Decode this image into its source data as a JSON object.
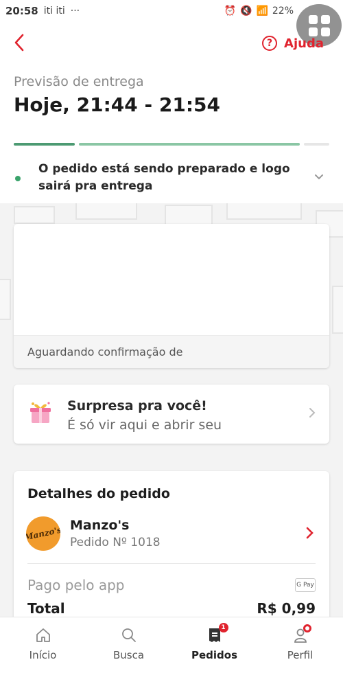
{
  "status_bar": {
    "time": "20:58",
    "apps": "iti iti",
    "more": "···",
    "battery": "22%"
  },
  "header": {
    "help_label": "Ajuda"
  },
  "delivery": {
    "estimate_label": "Previsão de entrega",
    "estimate_time": "Hoje, 21:44 - 21:54",
    "status_text": "O pedido está sendo preparado e logo sairá pra entrega"
  },
  "store_card": {
    "footer_text": "Aguardando confirmação de"
  },
  "surprise": {
    "title": "Surpresa pra você!",
    "subtitle": "É só vir aqui e abrir seu"
  },
  "order_details": {
    "heading": "Detalhes do pedido",
    "store_name": "Manzo's",
    "logo_text": "Manzo's",
    "order_number": "Pedido Nº 1018",
    "payment_label": "Pago pelo app",
    "payment_method": "G Pay",
    "total_label": "Total",
    "total_value": "R$ 0,99"
  },
  "bottom_nav": {
    "items": [
      {
        "label": "Início"
      },
      {
        "label": "Busca"
      },
      {
        "label": "Pedidos",
        "badge": "1"
      },
      {
        "label": "Perfil"
      }
    ]
  },
  "colors": {
    "accent": "#e0232e",
    "progress_done": "#4c9a72",
    "progress_active": "#8ac6a4",
    "status_dot": "#3aa36b"
  }
}
